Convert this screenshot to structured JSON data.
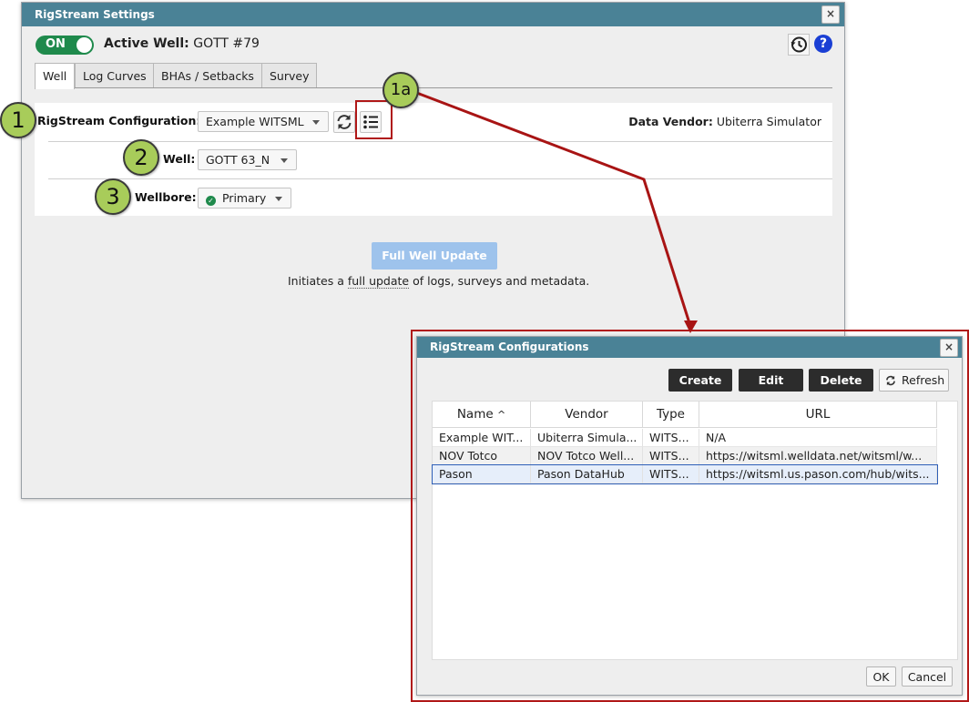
{
  "settings": {
    "title": "RigStream Settings",
    "close_icon": "×",
    "toggle_label": "ON",
    "active_well_label": "Active Well:",
    "active_well_value": "GOTT #79",
    "tabs": [
      {
        "label": "Well"
      },
      {
        "label": "Log Curves"
      },
      {
        "label": "BHAs / Setbacks"
      },
      {
        "label": "Survey"
      }
    ],
    "config_label": "RigStream Configuration:",
    "config_value": "Example WITSML",
    "data_vendor_label": "Data Vendor:",
    "data_vendor_value": "Ubiterra Simulator",
    "well_label": "Well:",
    "well_value": "GOTT 63_N",
    "wellbore_label": "Wellbore:",
    "wellbore_value": "Primary",
    "full_update_button": "Full Well Update",
    "hint_prefix": "Initiates a ",
    "hint_link": "full update",
    "hint_suffix": " of logs, surveys and metadata."
  },
  "callouts": {
    "one": "1",
    "two": "2",
    "three": "3",
    "one_a": "1a"
  },
  "configs": {
    "title": "RigStream Configurations",
    "close_icon": "×",
    "create": "Create",
    "edit": "Edit",
    "delete": "Delete",
    "refresh": "Refresh",
    "columns": [
      "Name",
      "Vendor",
      "Type",
      "URL"
    ],
    "sort_indicator": "^",
    "rows": [
      {
        "name": "Example WIT...",
        "vendor": "Ubiterra Simula...",
        "type": "WITS...",
        "url": "N/A"
      },
      {
        "name": "NOV Totco",
        "vendor": "NOV Totco Well...",
        "type": "WITS...",
        "url": "https://witsml.welldata.net/witsml/w..."
      },
      {
        "name": "Pason",
        "vendor": "Pason DataHub",
        "type": "WITS...",
        "url": "https://witsml.us.pason.com/hub/wits..."
      }
    ],
    "ok": "OK",
    "cancel": "Cancel"
  },
  "colors": {
    "titlebar": "#4a8296",
    "toggle_on": "#1f8a4c",
    "annotation_red": "#b01818",
    "callout_green": "#a8cc5a",
    "help_blue": "#1a3fd4"
  }
}
